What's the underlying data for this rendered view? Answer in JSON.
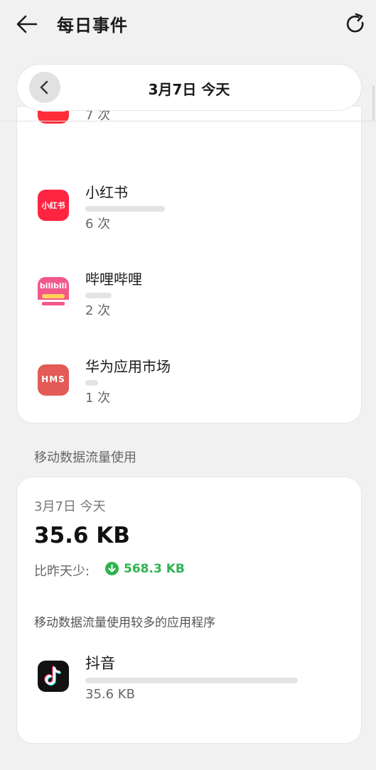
{
  "header": {
    "title": "每日事件"
  },
  "date_selector": {
    "label": "3月7日 今天"
  },
  "apps": [
    {
      "name": "",
      "count": "7 次",
      "icon": "partial-red-app-icon"
    },
    {
      "name": "小红书",
      "count": "6 次",
      "icon_text": "小红书",
      "color": "#ff2442"
    },
    {
      "name": "哔哩哔哩",
      "count": "2 次",
      "icon_text": "bilibili",
      "color": "#f1598b"
    },
    {
      "name": "华为应用市场",
      "count": "1 次",
      "icon_text": "HMS",
      "color": "#e45a56"
    }
  ],
  "data_section": {
    "title": "移动数据流量使用",
    "date": "3月7日 今天",
    "total": "35.6 KB",
    "compare_label": "比昨天少:",
    "compare_value": "568.3 KB",
    "compare_color": "#2eb34f",
    "top_apps_title": "移动数据流量使用较多的应用程序",
    "top_apps": [
      {
        "name": "抖音",
        "usage": "35.6 KB",
        "icon": "tiktok-icon"
      }
    ]
  }
}
